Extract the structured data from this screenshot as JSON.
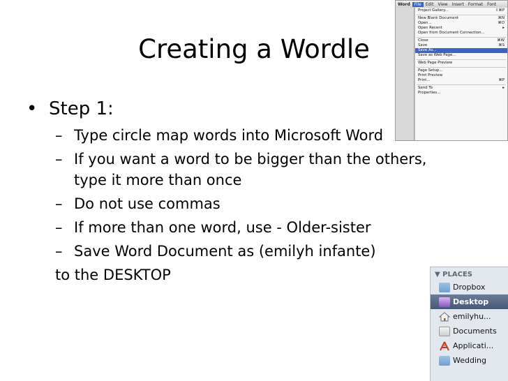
{
  "slide": {
    "title": "Creating a Wordle",
    "step_label": "Step 1:",
    "sub_bullets": [
      "Type circle map words into Microsoft Word",
      "If you want a word to be bigger than the others, type it more than once",
      "Do not use commas",
      "If more than one word, use -  Older-sister",
      "Save Word Document as (emilyh infante)"
    ],
    "trailing_line": "to the DESKTOP"
  },
  "word_menu": {
    "menubar": [
      "Word",
      "File",
      "Edit",
      "View",
      "Insert",
      "Format",
      "Font"
    ],
    "groups": [
      [
        {
          "label": "Project Gallery...",
          "shortcut": "⇧⌘P"
        },
        {
          "label": "New Blank Document",
          "shortcut": "⌘N"
        },
        {
          "label": "Open...",
          "shortcut": "⌘O"
        },
        {
          "label": "Open Recent",
          "shortcut": "▸"
        },
        {
          "label": "Open from Document Connection...",
          "shortcut": ""
        }
      ],
      [
        {
          "label": "Close",
          "shortcut": "⌘W"
        },
        {
          "label": "Save",
          "shortcut": "⌘S"
        },
        {
          "label": "Save As...",
          "shortcut": "",
          "selected": true
        },
        {
          "label": "Save as Web Page...",
          "shortcut": ""
        }
      ],
      [
        {
          "label": "Web Page Preview",
          "shortcut": ""
        }
      ],
      [
        {
          "label": "Page Setup...",
          "shortcut": ""
        },
        {
          "label": "Print Preview",
          "shortcut": ""
        },
        {
          "label": "Print...",
          "shortcut": "⌘P"
        }
      ],
      [
        {
          "label": "Send To",
          "shortcut": "▸"
        },
        {
          "label": "Properties...",
          "shortcut": ""
        }
      ]
    ]
  },
  "finder_sidebar": {
    "header": "▼ PLACES",
    "items": [
      {
        "label": "Dropbox",
        "icon": "folder-icon"
      },
      {
        "label": "Desktop",
        "icon": "desktop-icon",
        "selected": true
      },
      {
        "label": "emilyhu...",
        "icon": "home-icon"
      },
      {
        "label": "Documents",
        "icon": "documents-icon"
      },
      {
        "label": "Applicati...",
        "icon": "applications-icon"
      },
      {
        "label": "Wedding",
        "icon": "folder-icon"
      }
    ]
  }
}
